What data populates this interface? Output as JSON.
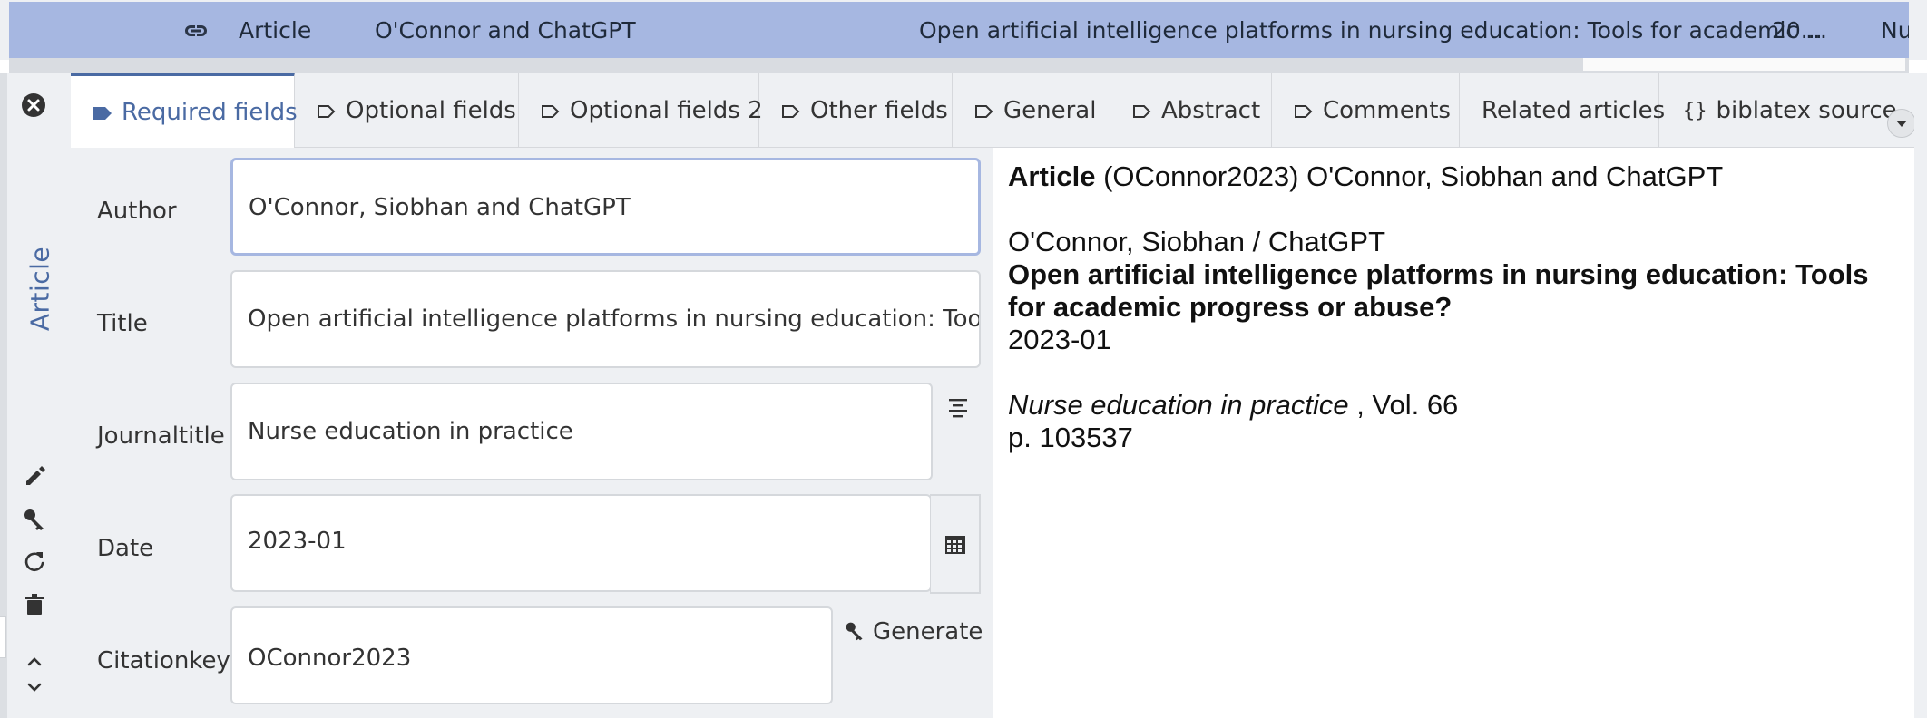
{
  "entry_row": {
    "type": "Article",
    "author": "O'Connor and ChatGPT",
    "title": "Open artificial intelligence platforms in nursing education: Tools for academic ...",
    "year": "20...",
    "journal": "Nu"
  },
  "side_panel": {
    "entry_type_tab": "Article",
    "icons": [
      "close-icon",
      "pencil-icon",
      "key-icon",
      "refresh-icon",
      "trash-icon",
      "chevron-up-icon",
      "chevron-down-icon"
    ]
  },
  "tabs": [
    {
      "label": "Required fields",
      "icon": "tag-filled-icon",
      "active": true
    },
    {
      "label": "Optional fields",
      "icon": "tag-outline-icon",
      "active": false
    },
    {
      "label": "Optional fields 2",
      "icon": "tag-outline-icon",
      "active": false
    },
    {
      "label": "Other fields",
      "icon": "tag-outline-icon",
      "active": false
    },
    {
      "label": "General",
      "icon": "tag-outline-icon",
      "active": false
    },
    {
      "label": "Abstract",
      "icon": "tag-outline-icon",
      "active": false
    },
    {
      "label": "Comments",
      "icon": "tag-outline-icon",
      "active": false
    },
    {
      "label": "Related articles",
      "icon": "",
      "active": false
    },
    {
      "label": "biblatex source",
      "icon": "braces-icon",
      "active": false
    }
  ],
  "fields": {
    "author": {
      "label": "Author",
      "value": "O'Connor, Siobhan and ChatGPT"
    },
    "title": {
      "label": "Title",
      "value": "Open artificial intelligence platforms in nursing education: Tools for academic progress or abuse?"
    },
    "journaltitle": {
      "label": "Journaltitle",
      "value": "Nurse education in practice"
    },
    "date": {
      "label": "Date",
      "value": "2023-01"
    },
    "citationkey": {
      "label": "Citationkey",
      "value": "OConnor2023"
    }
  },
  "generate_label": "Generate",
  "preview": {
    "type_bold": "Article",
    "header_rest": " (OConnor2023) O'Connor, Siobhan and ChatGPT",
    "authors": "O'Connor, Siobhan / ChatGPT",
    "title_line1": "Open artificial intelligence platforms in nursing education: Tools",
    "title_line2": "for academic progress or abuse?",
    "date": "2023-01",
    "journal": "Nurse education in practice",
    "volume": " , Vol. 66",
    "pages": "p. 103537"
  },
  "colors": {
    "selection": "#a6b7e1",
    "accent": "#4a6aa3",
    "panel": "#eef0f3"
  }
}
